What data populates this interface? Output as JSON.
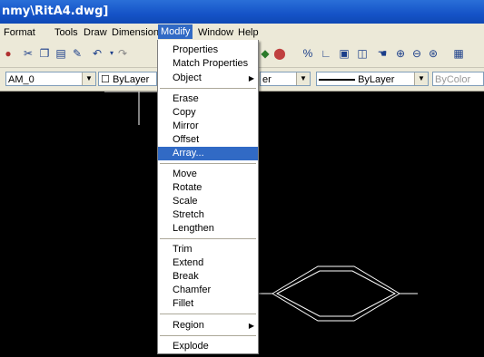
{
  "title": "nmy\\RitA4.dwg]",
  "menubar": [
    "Format",
    "Tools",
    "Draw",
    "Dimension",
    "Modify",
    "Window",
    "Help"
  ],
  "toolbar2": {
    "layer": "AM_0",
    "color": "ByLayer",
    "layer2": "er",
    "linetype": "ByLayer",
    "lineweight": "ByColor"
  },
  "menu": {
    "items": [
      {
        "label": "Properties"
      },
      {
        "label": "Match Properties"
      },
      {
        "label": "Object"
      },
      {
        "label": "Erase"
      },
      {
        "label": "Copy"
      },
      {
        "label": "Mirror"
      },
      {
        "label": "Offset"
      },
      {
        "label": "Array..."
      },
      {
        "label": "Move"
      },
      {
        "label": "Rotate"
      },
      {
        "label": "Scale"
      },
      {
        "label": "Stretch"
      },
      {
        "label": "Lengthen"
      },
      {
        "label": "Trim"
      },
      {
        "label": "Extend"
      },
      {
        "label": "Break"
      },
      {
        "label": "Chamfer"
      },
      {
        "label": "Fillet"
      },
      {
        "label": "Region"
      },
      {
        "label": "Explode"
      }
    ]
  },
  "colors": {
    "highlight": "#316ac5",
    "menubar": "#ece9d8",
    "titlebar": "#1553c7"
  }
}
